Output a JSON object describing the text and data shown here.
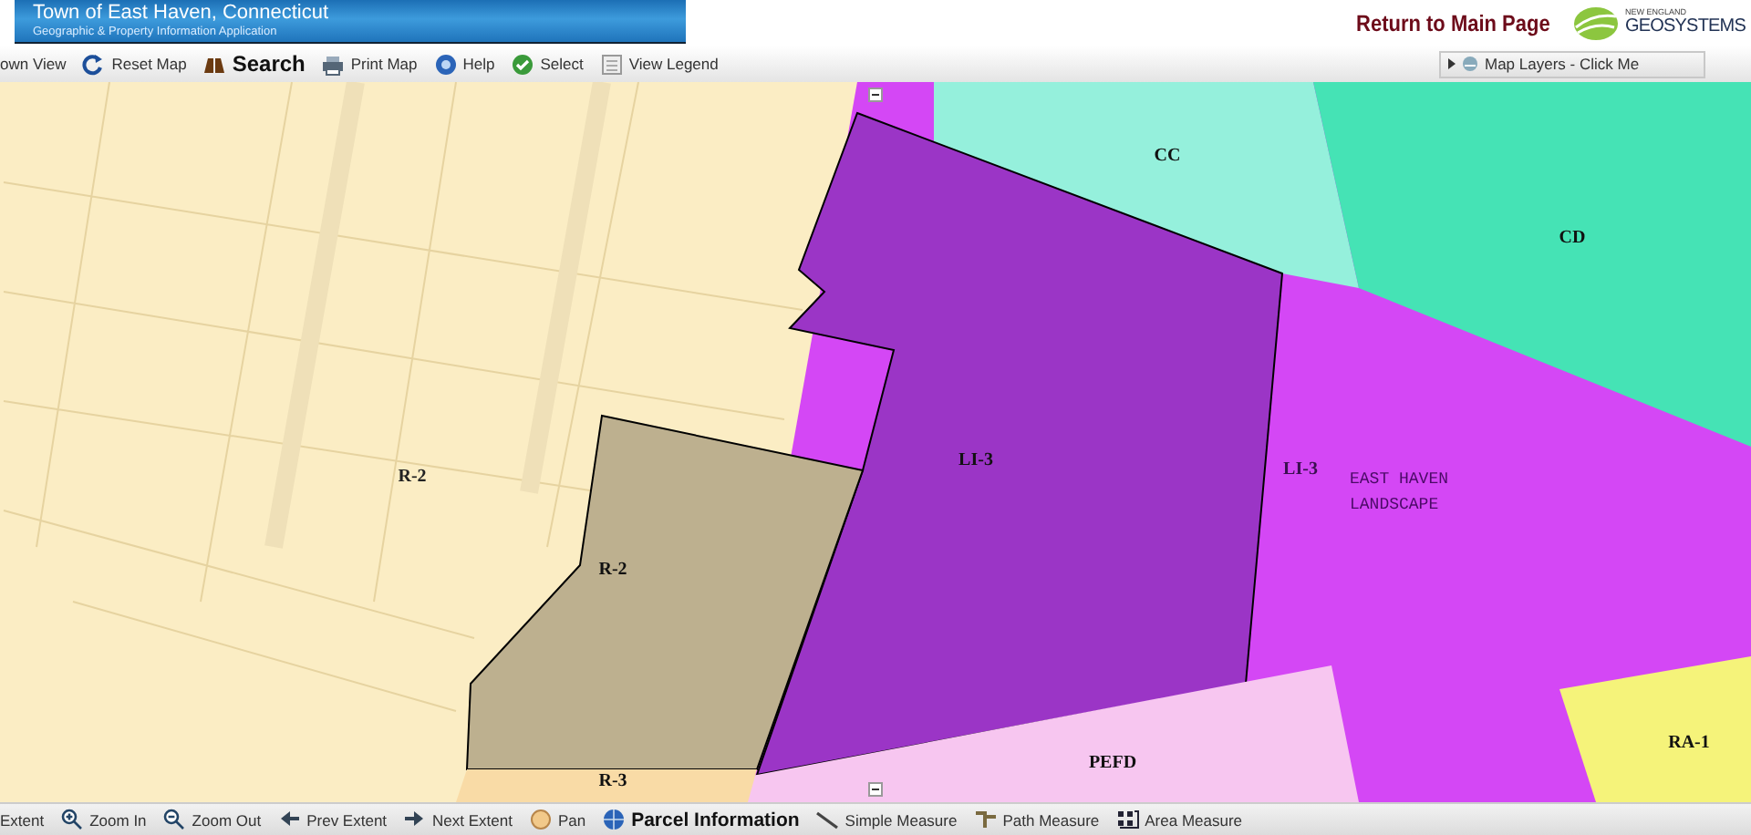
{
  "header": {
    "title": "Town of East Haven, Connecticut",
    "subtitle": "Geographic & Property Information Application",
    "return_link": "Return to Main Page",
    "logo": {
      "small": "NEW ENGLAND",
      "name": "GEOSYSTEMS"
    }
  },
  "toolbar": [
    {
      "label": "own View",
      "kind": "plain"
    },
    {
      "label": "Reset Map",
      "kind": "plain"
    },
    {
      "label": "Search",
      "kind": "primary"
    },
    {
      "label": "Print Map",
      "kind": "plain"
    },
    {
      "label": "Help",
      "kind": "plain"
    },
    {
      "label": "Select",
      "kind": "plain"
    },
    {
      "label": "View Legend",
      "kind": "plain"
    }
  ],
  "map_layers": {
    "label": "Map Layers - Click Me",
    "expanded": false
  },
  "map": {
    "zones": [
      {
        "label": "R-2",
        "color": "#fbedc4"
      },
      {
        "label": "LI-3",
        "color": "#d447f5"
      },
      {
        "label": "CC",
        "color": "#95f0dc"
      },
      {
        "label": "CD",
        "color": "#45e3b5"
      },
      {
        "label": "LI-3",
        "color": "#9b35c6"
      },
      {
        "label": "R-2",
        "color": "#bdb08f"
      },
      {
        "label": "PEFD",
        "color": "#f7c6f0"
      },
      {
        "label": "R-3",
        "color": "#f9dba6"
      },
      {
        "label": "RA-1",
        "color": "#f5f37a"
      }
    ],
    "annotations": [
      "EAST HAVEN",
      "LANDSCAPE"
    ]
  },
  "bottom_toolbar": [
    {
      "label": "Extent",
      "kind": "plain"
    },
    {
      "label": "Zoom In",
      "kind": "plain"
    },
    {
      "label": "Zoom Out",
      "kind": "plain"
    },
    {
      "label": "Prev Extent",
      "kind": "plain"
    },
    {
      "label": "Next Extent",
      "kind": "plain"
    },
    {
      "label": "Pan",
      "kind": "plain"
    },
    {
      "label": "Parcel Information",
      "kind": "primary"
    },
    {
      "label": "Simple Measure",
      "kind": "plain"
    },
    {
      "label": "Path Measure",
      "kind": "plain"
    },
    {
      "label": "Area Measure",
      "kind": "plain"
    }
  ]
}
